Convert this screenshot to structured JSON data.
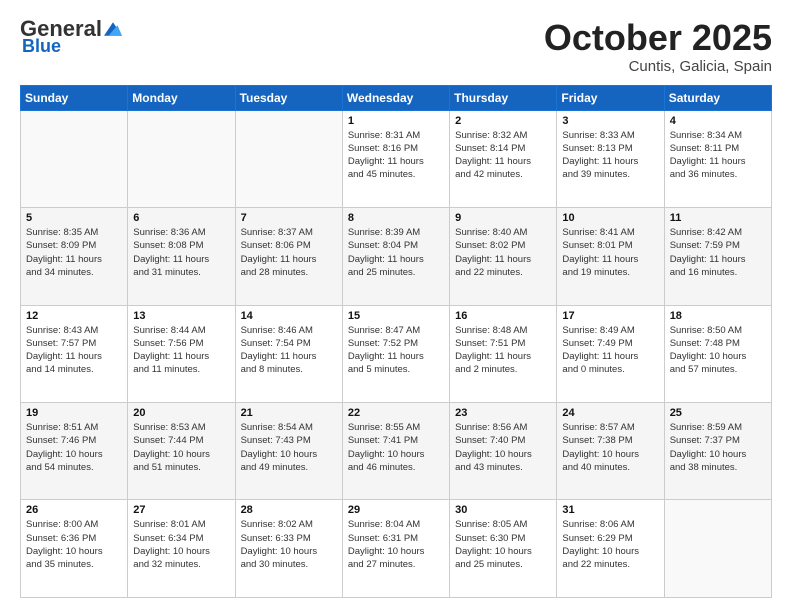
{
  "logo": {
    "general": "General",
    "blue": "Blue"
  },
  "header": {
    "title": "October 2025",
    "subtitle": "Cuntis, Galicia, Spain"
  },
  "weekdays": [
    "Sunday",
    "Monday",
    "Tuesday",
    "Wednesday",
    "Thursday",
    "Friday",
    "Saturday"
  ],
  "weeks": [
    [
      {
        "day": "",
        "info": ""
      },
      {
        "day": "",
        "info": ""
      },
      {
        "day": "",
        "info": ""
      },
      {
        "day": "1",
        "info": "Sunrise: 8:31 AM\nSunset: 8:16 PM\nDaylight: 11 hours\nand 45 minutes."
      },
      {
        "day": "2",
        "info": "Sunrise: 8:32 AM\nSunset: 8:14 PM\nDaylight: 11 hours\nand 42 minutes."
      },
      {
        "day": "3",
        "info": "Sunrise: 8:33 AM\nSunset: 8:13 PM\nDaylight: 11 hours\nand 39 minutes."
      },
      {
        "day": "4",
        "info": "Sunrise: 8:34 AM\nSunset: 8:11 PM\nDaylight: 11 hours\nand 36 minutes."
      }
    ],
    [
      {
        "day": "5",
        "info": "Sunrise: 8:35 AM\nSunset: 8:09 PM\nDaylight: 11 hours\nand 34 minutes."
      },
      {
        "day": "6",
        "info": "Sunrise: 8:36 AM\nSunset: 8:08 PM\nDaylight: 11 hours\nand 31 minutes."
      },
      {
        "day": "7",
        "info": "Sunrise: 8:37 AM\nSunset: 8:06 PM\nDaylight: 11 hours\nand 28 minutes."
      },
      {
        "day": "8",
        "info": "Sunrise: 8:39 AM\nSunset: 8:04 PM\nDaylight: 11 hours\nand 25 minutes."
      },
      {
        "day": "9",
        "info": "Sunrise: 8:40 AM\nSunset: 8:02 PM\nDaylight: 11 hours\nand 22 minutes."
      },
      {
        "day": "10",
        "info": "Sunrise: 8:41 AM\nSunset: 8:01 PM\nDaylight: 11 hours\nand 19 minutes."
      },
      {
        "day": "11",
        "info": "Sunrise: 8:42 AM\nSunset: 7:59 PM\nDaylight: 11 hours\nand 16 minutes."
      }
    ],
    [
      {
        "day": "12",
        "info": "Sunrise: 8:43 AM\nSunset: 7:57 PM\nDaylight: 11 hours\nand 14 minutes."
      },
      {
        "day": "13",
        "info": "Sunrise: 8:44 AM\nSunset: 7:56 PM\nDaylight: 11 hours\nand 11 minutes."
      },
      {
        "day": "14",
        "info": "Sunrise: 8:46 AM\nSunset: 7:54 PM\nDaylight: 11 hours\nand 8 minutes."
      },
      {
        "day": "15",
        "info": "Sunrise: 8:47 AM\nSunset: 7:52 PM\nDaylight: 11 hours\nand 5 minutes."
      },
      {
        "day": "16",
        "info": "Sunrise: 8:48 AM\nSunset: 7:51 PM\nDaylight: 11 hours\nand 2 minutes."
      },
      {
        "day": "17",
        "info": "Sunrise: 8:49 AM\nSunset: 7:49 PM\nDaylight: 11 hours\nand 0 minutes."
      },
      {
        "day": "18",
        "info": "Sunrise: 8:50 AM\nSunset: 7:48 PM\nDaylight: 10 hours\nand 57 minutes."
      }
    ],
    [
      {
        "day": "19",
        "info": "Sunrise: 8:51 AM\nSunset: 7:46 PM\nDaylight: 10 hours\nand 54 minutes."
      },
      {
        "day": "20",
        "info": "Sunrise: 8:53 AM\nSunset: 7:44 PM\nDaylight: 10 hours\nand 51 minutes."
      },
      {
        "day": "21",
        "info": "Sunrise: 8:54 AM\nSunset: 7:43 PM\nDaylight: 10 hours\nand 49 minutes."
      },
      {
        "day": "22",
        "info": "Sunrise: 8:55 AM\nSunset: 7:41 PM\nDaylight: 10 hours\nand 46 minutes."
      },
      {
        "day": "23",
        "info": "Sunrise: 8:56 AM\nSunset: 7:40 PM\nDaylight: 10 hours\nand 43 minutes."
      },
      {
        "day": "24",
        "info": "Sunrise: 8:57 AM\nSunset: 7:38 PM\nDaylight: 10 hours\nand 40 minutes."
      },
      {
        "day": "25",
        "info": "Sunrise: 8:59 AM\nSunset: 7:37 PM\nDaylight: 10 hours\nand 38 minutes."
      }
    ],
    [
      {
        "day": "26",
        "info": "Sunrise: 8:00 AM\nSunset: 6:36 PM\nDaylight: 10 hours\nand 35 minutes."
      },
      {
        "day": "27",
        "info": "Sunrise: 8:01 AM\nSunset: 6:34 PM\nDaylight: 10 hours\nand 32 minutes."
      },
      {
        "day": "28",
        "info": "Sunrise: 8:02 AM\nSunset: 6:33 PM\nDaylight: 10 hours\nand 30 minutes."
      },
      {
        "day": "29",
        "info": "Sunrise: 8:04 AM\nSunset: 6:31 PM\nDaylight: 10 hours\nand 27 minutes."
      },
      {
        "day": "30",
        "info": "Sunrise: 8:05 AM\nSunset: 6:30 PM\nDaylight: 10 hours\nand 25 minutes."
      },
      {
        "day": "31",
        "info": "Sunrise: 8:06 AM\nSunset: 6:29 PM\nDaylight: 10 hours\nand 22 minutes."
      },
      {
        "day": "",
        "info": ""
      }
    ]
  ]
}
